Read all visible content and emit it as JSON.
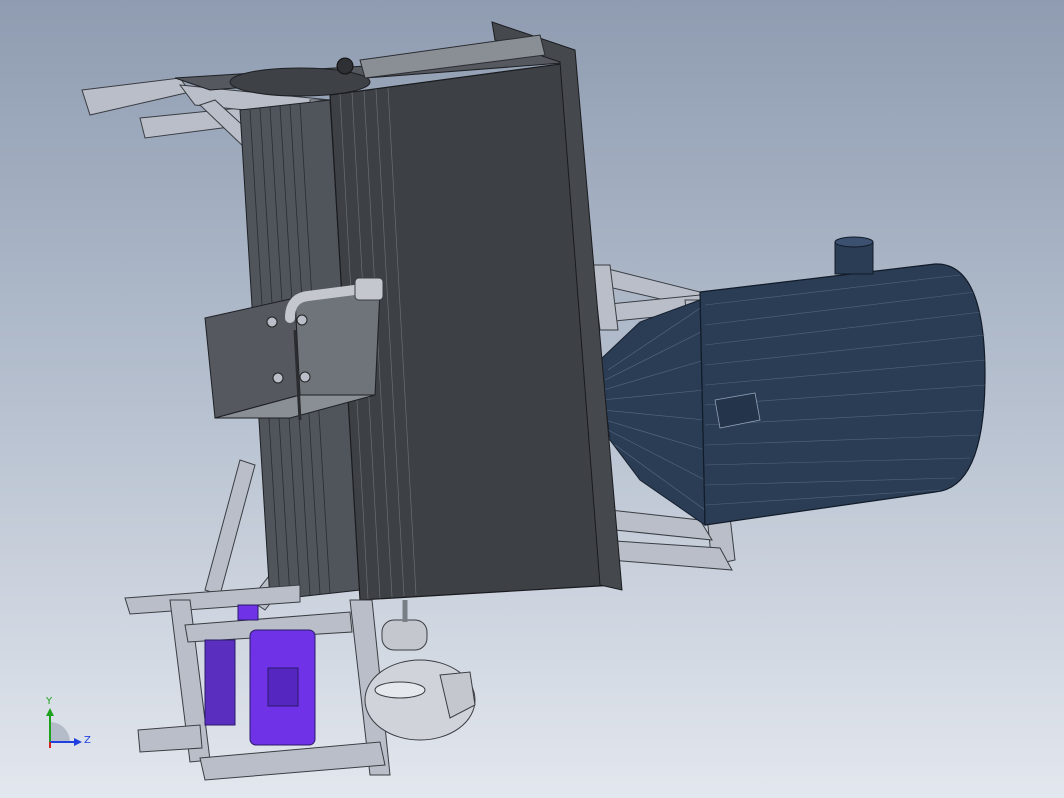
{
  "viewport": {
    "background_top": "#8f9cb1",
    "background_bottom": "#e3e7ee"
  },
  "model": {
    "parts": [
      "frame",
      "feed-hopper",
      "burner-cylinder",
      "nozzle-cone",
      "exhaust-stack",
      "bracket-box",
      "motor",
      "fan",
      "flange"
    ],
    "colors": {
      "frame": "#b9bec8",
      "hopper": "#3d4044",
      "burner": "#2b3d55",
      "motor": "#6f32e6"
    }
  },
  "triad": {
    "y_label": "Y",
    "z_label": "Z",
    "y_color": "#1fa01f",
    "z_color": "#1f3fe0",
    "x_color": "#d42020"
  }
}
